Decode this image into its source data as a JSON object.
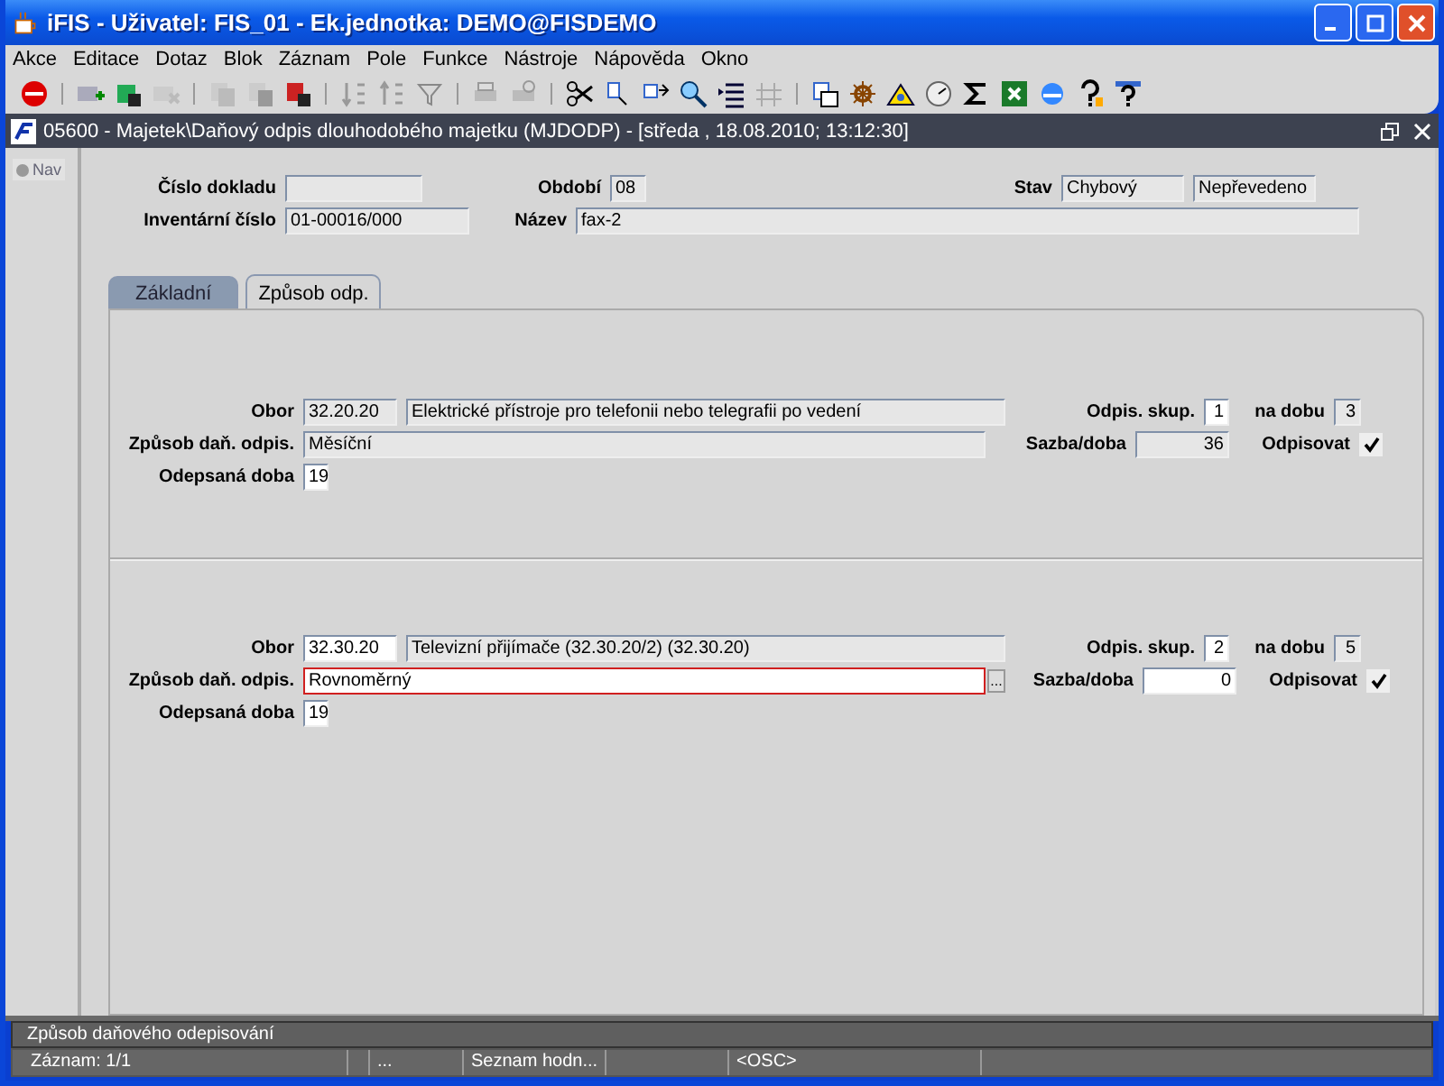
{
  "window": {
    "title": "iFIS - Uživatel: FIS_01 - Ek.jednotka: DEMO@FISDEMO"
  },
  "menu": [
    "Akce",
    "Editace",
    "Dotaz",
    "Blok",
    "Záznam",
    "Pole",
    "Funkce",
    "Nástroje",
    "Nápověda",
    "Okno"
  ],
  "form_window": {
    "title": "05600 - Majetek\\Daňový odpis dlouhodobého majetku (MJDODP) - [středa , 18.08.2010; 13:12:30]"
  },
  "nav": {
    "label": "Nav"
  },
  "header": {
    "document_number": {
      "label": "Číslo dokladu"
    },
    "period": {
      "label": "Období",
      "value": "08"
    },
    "status": {
      "label": "Stav",
      "values": [
        "Chybový",
        "Nepřevedeno"
      ]
    },
    "inventory_number": {
      "label": "Inventární číslo",
      "value": "01-00016/000"
    },
    "name": {
      "label": "Název",
      "value": "fax-2"
    }
  },
  "tabs": [
    {
      "label": "Základní",
      "selected": false
    },
    {
      "label": "Způsob odp.",
      "selected": true
    }
  ],
  "sections": [
    {
      "editable": false,
      "focused": false,
      "branch": {
        "label": "Obor",
        "code": "32.20.20",
        "name": "Elektrické přístroje pro telefonii nebo telegrafii po vedení"
      },
      "method": {
        "label": "Způsob daň. odpis.",
        "value": "Měsíční"
      },
      "elapsed": {
        "label": "Odepsaná doba",
        "value": "19"
      },
      "group": {
        "label": "Odpis. skup.",
        "value": "1"
      },
      "period": {
        "label": "na dobu",
        "value": "3"
      },
      "rate": {
        "label": "Sazba/doba",
        "value": "36"
      },
      "depreciate": {
        "label": "Odpisovat",
        "checked": true
      }
    },
    {
      "editable": true,
      "focused": true,
      "branch": {
        "label": "Obor",
        "code": "32.30.20",
        "name": "Televizní přijímače (32.30.20/2) (32.30.20)"
      },
      "method": {
        "label": "Způsob daň. odpis.",
        "value": "Rovnoměrný",
        "button": "..."
      },
      "elapsed": {
        "label": "Odepsaná doba",
        "value": "19"
      },
      "group": {
        "label": "Odpis. skup.",
        "value": "2"
      },
      "period": {
        "label": "na dobu",
        "value": "5"
      },
      "rate": {
        "label": "Sazba/doba",
        "value": "0"
      },
      "depreciate": {
        "label": "Odpisovat",
        "checked": true
      }
    }
  ],
  "hint_bar": "Způsob daňového odepisování",
  "status_bar": [
    "Záznam: 1/1",
    "...",
    "Seznam hodn...",
    "<OSC>"
  ]
}
